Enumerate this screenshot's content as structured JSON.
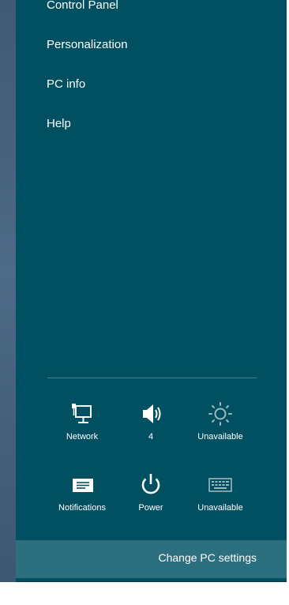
{
  "settings_menu": {
    "items": [
      {
        "label": "Control Panel"
      },
      {
        "label": "Personalization"
      },
      {
        "label": "PC info"
      },
      {
        "label": "Help"
      }
    ]
  },
  "quick_settings": [
    {
      "label": "Network",
      "icon": "network-icon",
      "state": "enabled"
    },
    {
      "label": "4",
      "icon": "volume-icon",
      "state": "enabled"
    },
    {
      "label": "Unavailable",
      "icon": "brightness-icon",
      "state": "disabled"
    },
    {
      "label": "Notifications",
      "icon": "notifications-icon",
      "state": "enabled"
    },
    {
      "label": "Power",
      "icon": "power-icon",
      "state": "enabled"
    },
    {
      "label": "Unavailable",
      "icon": "keyboard-icon",
      "state": "disabled"
    }
  ],
  "footer": {
    "change_pc_settings_label": "Change PC settings"
  },
  "colors": {
    "pane_background": "#005061",
    "footer_background": "#2c6f7e",
    "text": "#ffffff",
    "disabled_icon": "#9fb7bd"
  }
}
